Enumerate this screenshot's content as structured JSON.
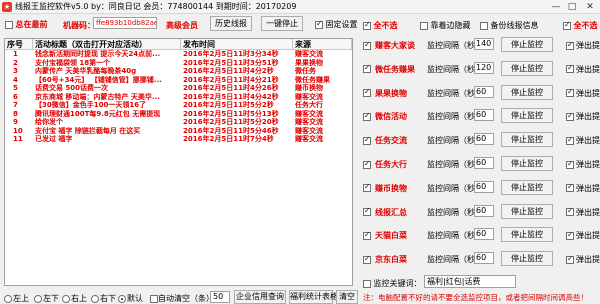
{
  "window": {
    "title": "线报王监控软件v5.0 by：同良日记 会员：774800144 到期时间：20170209",
    "minimize": "—",
    "maximize": "□",
    "close": "✕"
  },
  "top": {
    "always_on_top": "总在最前",
    "machine_code_label": "机器码：",
    "machine_code": "ffe893b10db82ae",
    "vip_label": "高级会员",
    "history_button": "历史线报",
    "stop_all_button": "一键停止",
    "pin_settings": "固定设置"
  },
  "table": {
    "headers": [
      "序号",
      "活动标题（双击打开对应活动）",
      "发布时间",
      "来源"
    ],
    "rows": [
      [
        "1",
        "钱念新活期同时提现 提示今天24点前...",
        "2016年2月5日11时3分34秒",
        "赚客交流"
      ],
      [
        "2",
        "支付宝福袋领 18第一个",
        "2016年2月5日11时3分51秒",
        "果果换物"
      ],
      [
        "3",
        "内蒙传产 天美华乳酪每晚茶40g",
        "2016年2月5日11时4分2秒",
        "微任务"
      ],
      [
        "4",
        "【60号+34元】 【铺铺信管】挪挪铺...",
        "2016年2月5日11时4分21秒",
        "微任务赚果"
      ],
      [
        "5",
        "话费交易 500话费一次",
        "2016年2月5日11时4分26秒",
        "赚币换物"
      ],
      [
        "6",
        "京东商城 移动端：内蒙古特产 天美华...",
        "2016年2月5日11时4分42秒",
        "赚客交流"
      ],
      [
        "7",
        "【30微信】金色手100一天领16了",
        "2016年2月5日11时5分2秒",
        "任务大行"
      ],
      [
        "8",
        "腾讯理财通100T每9.8元红包 无需提现",
        "2016年2月5日11时5分13秒",
        "赚客交流"
      ],
      [
        "9",
        "给你发个",
        "2016年2月5日11时5分20秒",
        "赚客交流"
      ],
      [
        "10",
        "支付宝 福字 除链拦截每月 在这买",
        "2016年2月5日11时5分46秒",
        "赚客交流"
      ],
      [
        "11",
        "已发过 福字",
        "2016年2月5日11时7分4秒",
        "赚客交流"
      ]
    ]
  },
  "panel": {
    "select_all_left": "全不选",
    "edge_hide": "靠着边隐藏",
    "backup_logs": "备份线报信息",
    "select_all_right": "全不选",
    "interval_label": "监控间隔（秒）",
    "stop_label": "停止监控",
    "popup_label": "弹出提示",
    "monitors": [
      {
        "name": "赚客大家谈",
        "interval": "140"
      },
      {
        "name": "微任务赚果",
        "interval": "120"
      },
      {
        "name": "果果换物",
        "interval": "60"
      },
      {
        "name": "微信活动",
        "interval": "60"
      },
      {
        "name": "任务交流",
        "interval": "60"
      },
      {
        "name": "任务大行",
        "interval": "60"
      },
      {
        "name": "赚币换物",
        "interval": "60"
      },
      {
        "name": "线报汇总",
        "interval": "60"
      },
      {
        "name": "天猫白菜",
        "interval": "60"
      },
      {
        "name": "京东白菜",
        "interval": "60"
      }
    ],
    "keyword_label": "监控关键词：",
    "keyword_value": "福利|红包|话费",
    "warning": "注：电脑配置不好的请不要全选监控项目，或者把间隔时间调高些！"
  },
  "bottom": {
    "positions": [
      "左上",
      "左下",
      "右上",
      "右下",
      "默认"
    ],
    "auto_confirm": "自动清空（条）",
    "auto_count": "50",
    "enterprise_button": "企业信用查询",
    "stats_button": "福利统计表格",
    "clear_button": "清空"
  }
}
